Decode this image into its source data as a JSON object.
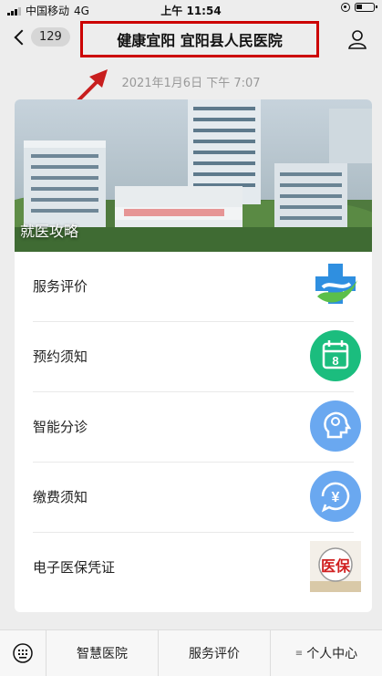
{
  "status": {
    "carrier": "中国移动",
    "network": "4G",
    "time": "上午 11:54"
  },
  "nav": {
    "back_count": "129",
    "title": "健康宜阳 宜阳县人民医院"
  },
  "article": {
    "date": "2021年1月6日 下午 7:07",
    "banner_label": "就医攻略",
    "items": [
      {
        "label": "服务评价",
        "icon": "hospital-cross-icon",
        "color": "#2f8fe0"
      },
      {
        "label": "预约须知",
        "icon": "calendar-icon",
        "color": "#1bbd7e"
      },
      {
        "label": "智能分诊",
        "icon": "head-brain-icon",
        "color": "#6aa8f0"
      },
      {
        "label": "缴费须知",
        "icon": "yuan-payment-icon",
        "color": "#6aa8f0"
      },
      {
        "label": "电子医保凭证",
        "icon": "medical-insurance-icon",
        "color": "#d02020"
      }
    ]
  },
  "icons_text": {
    "calendar_day": "8",
    "yuan": "¥",
    "insurance": "医保"
  },
  "bottom_bar": {
    "tabs": [
      "智慧医院",
      "服务评价",
      "个人中心"
    ]
  },
  "colors": {
    "highlight": "#cc0000",
    "background": "#ededed"
  }
}
